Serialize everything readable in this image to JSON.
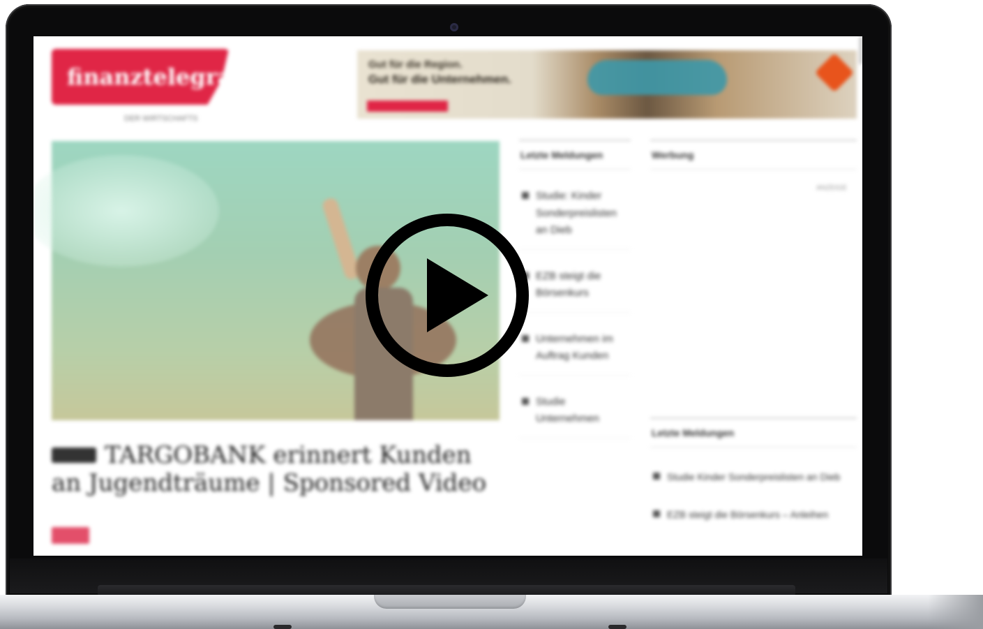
{
  "site": {
    "logo_text": "finanztelegraph",
    "tagline": "DER WIRTSCHAFTS"
  },
  "banner": {
    "line1": "Gut für die Region.",
    "line2": "Gut für die Unternehmen.",
    "cta": "",
    "sub": ""
  },
  "article": {
    "kicker": "",
    "headline": "TARGOBANK erinnert Kunden an Jugendträume | Sponsored Video",
    "teaser_tag": "",
    "teaser": ""
  },
  "middle_column": {
    "section_title": "Letzte Meldungen",
    "stories": [
      "Studie: Kinder Sonderpreislisten an Dieb",
      "EZB steigt die Börsenkurs",
      "Unternehmen im Auftrag Kunden",
      "Studie Unternehmen"
    ]
  },
  "right_column": {
    "section_title": "Werbung",
    "anzeige": "ANZEIGE",
    "lower_section_title": "Letzte Meldungen",
    "stories": [
      "Studie Kinder Sonderpreislisten an Dieb",
      "EZB steigt die Börsenkurs – Anleihen"
    ]
  },
  "video": {
    "play_icon": "play-icon"
  }
}
